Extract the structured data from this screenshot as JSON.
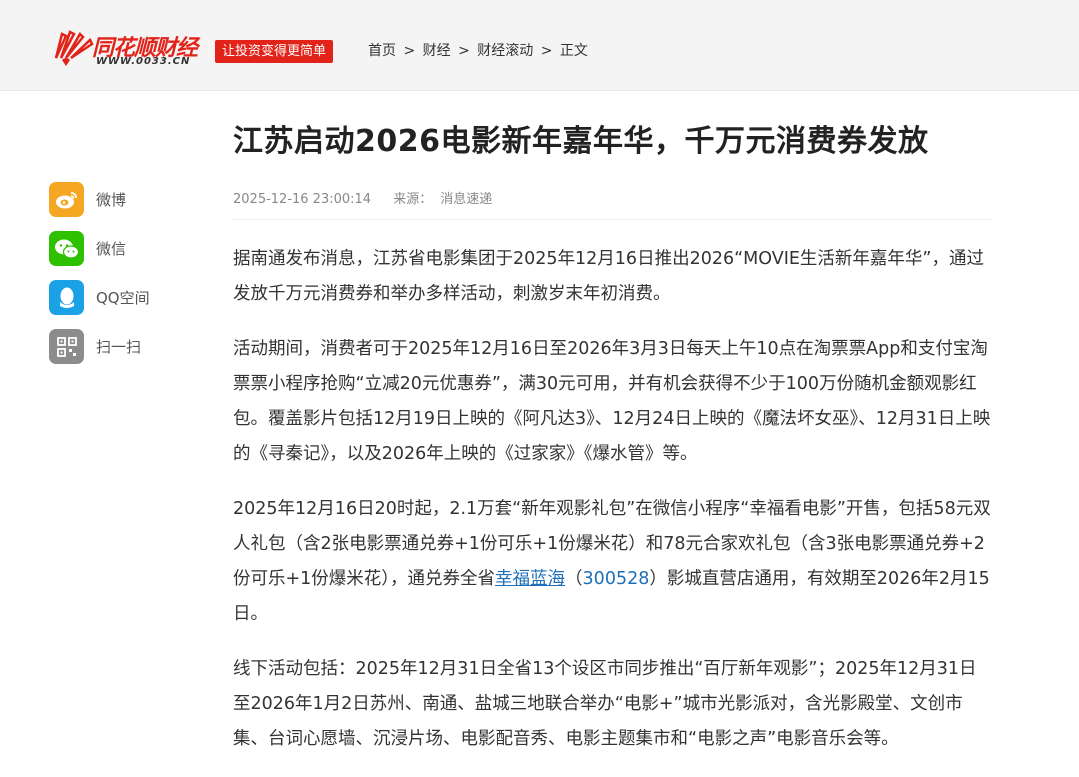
{
  "header": {
    "logo_text": "同花顺财经",
    "logo_url": "WWW.0033.CN",
    "slogan": "让投资变得更简单",
    "breadcrumb": {
      "home": "首页",
      "finance": "财经",
      "rolling": "财经滚动",
      "current": "正文",
      "sep": ">"
    }
  },
  "share": {
    "weibo": "微博",
    "wechat": "微信",
    "qzone": "QQ空间",
    "scan": "扫一扫"
  },
  "article": {
    "title": "江苏启动2026电影新年嘉年华，千万元消费券发放",
    "datetime": "2025-12-16 23:00:14",
    "source_label": "来源：",
    "source": "消息速递",
    "p1": "据南通发布消息，江苏省电影集团于2025年12月16日推出2026“MOVIE生活新年嘉年华”，通过发放千万元消费券和举办多样活动，刺激岁末年初消费。",
    "p2": "活动期间，消费者可于2025年12月16日至2026年3月3日每天上午10点在淘票票App和支付宝淘票票小程序抢购“立减20元优惠券”，满30元可用，并有机会获得不少于100万份随机金额观影红包。覆盖影片包括12月19日上映的《阿凡达3》、12月24日上映的《魔法坏女巫》、12月31日上映的《寻秦记》，以及2026年上映的《过家家》《爆水管》等。",
    "p3_before": "2025年12月16日20时起，2.1万套“新年观影礼包”在微信小程序“幸福看电影”开售，包括58元双人礼包（含2张电影票通兑券+1份可乐+1份爆米花）和78元合家欢礼包（含3张电影票通兑券+2份可乐+1份爆米花），通兑券全省",
    "p3_link": "幸福蓝海",
    "p3_paren_open": "（",
    "p3_code": "300528",
    "p3_after": "）影城直营店通用，有效期至2026年2月15日。",
    "p4": "线下活动包括：2025年12月31日全省13个设区市同步推出“百厅新年观影”；2025年12月31日至2026年1月2日苏州、南通、盐城三地联合举办“电影+”城市光影派对，含光影殿堂、文创市集、台词心愿墙、沉浸片场、电影配音秀、电影主题集市和“电影之声”电影音乐会等。"
  },
  "colors": {
    "brand_red": "#e2231a",
    "link_blue": "#1e6fb8",
    "weibo": "#f5a623",
    "wechat": "#2dc100",
    "qzone": "#1aa1e6",
    "scan": "#8c8c8c"
  }
}
